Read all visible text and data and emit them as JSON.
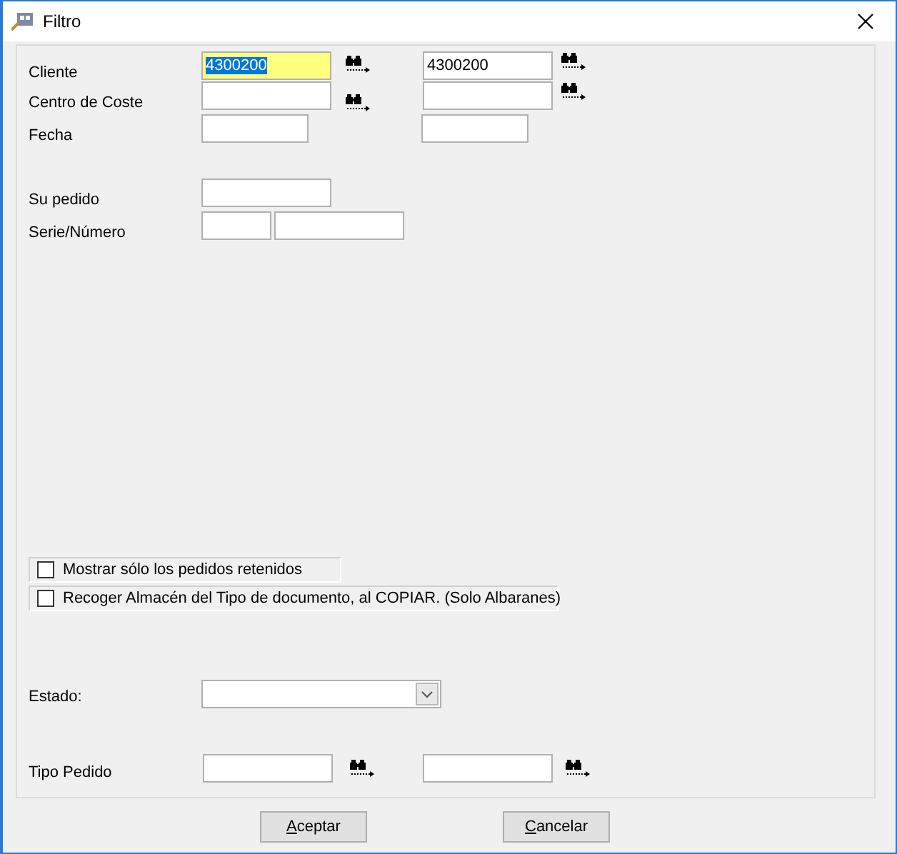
{
  "window": {
    "title": "Filtro"
  },
  "filters": [
    {
      "label": "Cliente",
      "kind": "range",
      "from": "4300200",
      "to": "4300200",
      "focused": true
    },
    {
      "label": "Centro de Coste",
      "kind": "range",
      "focused": false
    },
    {
      "label": "Fecha",
      "kind": "short_range",
      "focused": false
    },
    {
      "label": "Su pedido",
      "kind": "single",
      "focused": false
    },
    {
      "label": "Serie/Número",
      "kind": "serie",
      "focused": false
    }
  ],
  "options": [
    {
      "label": "Mostrar sólo los pedidos retenidos",
      "checked": false
    },
    {
      "label": "Recoger Almacén del Tipo de documento, al COPIAR. (Solo Albaranes)",
      "checked": false
    }
  ],
  "estado": {
    "label": "Estado:"
  },
  "tipo_pedido": {
    "label": "Tipo Pedido"
  },
  "buttons": [
    "Aceptar",
    "Cancelar"
  ]
}
